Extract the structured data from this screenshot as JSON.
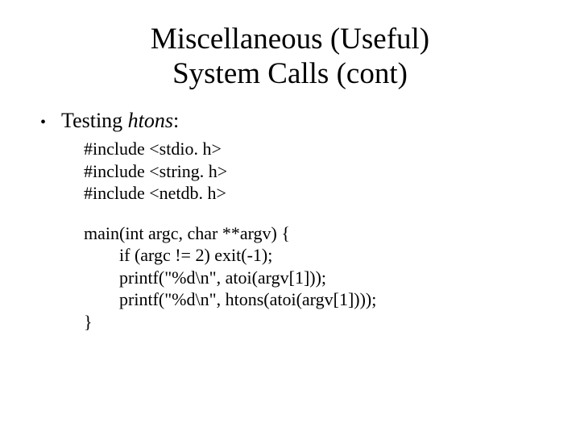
{
  "title_line1": "Miscellaneous (Useful)",
  "title_line2": "System Calls (cont)",
  "bullet": {
    "lead": "Testing ",
    "italic": "htons",
    "tail": ":"
  },
  "code": {
    "inc1": "#include <stdio. h>",
    "inc2": "#include <string. h>",
    "inc3": "#include <netdb. h>",
    "l1": "main(int argc, char **argv) {",
    "l2": "if (argc != 2) exit(-1);",
    "l3": "printf(\"%d\\n\", atoi(argv[1]));",
    "l4": "printf(\"%d\\n\", htons(atoi(argv[1])));",
    "l5": "}"
  }
}
